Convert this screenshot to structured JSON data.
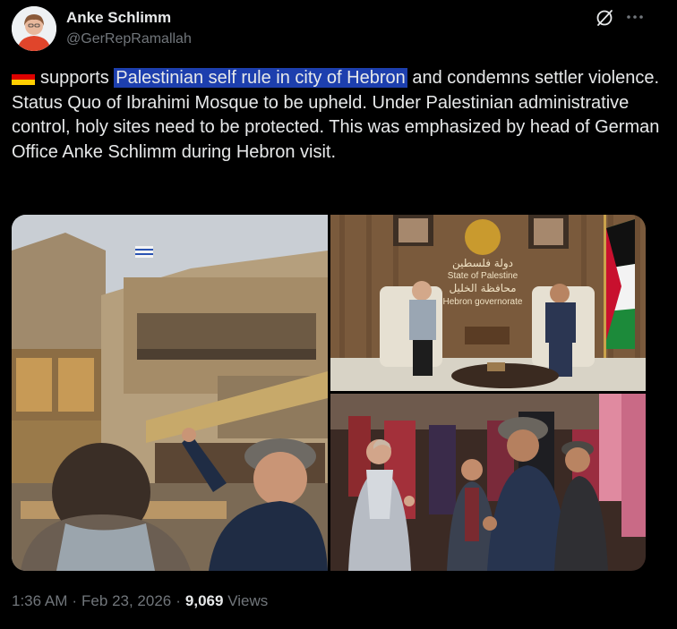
{
  "author": {
    "display_name": "Anke Schlimm",
    "handle": "@GerRepRamallah"
  },
  "post": {
    "flag_icon": "germany-flag-icon",
    "text_before": "supports ",
    "text_highlight": "Palestinian self rule in city of Hebron",
    "text_after": " and condemns settler violence. Status Quo of Ibrahimi Mosque to be upheld. Under Palestinian administrative control, holy sites need to be protected. This was emphasized by head of German Office Anke Schlimm during Hebron visit.",
    "highlight_color": "#1d3fae"
  },
  "media": {
    "photo_meeting": {
      "wall_sign_arabic_1": "دولة فلسطين",
      "wall_sign_english_1": "State of Palestine",
      "wall_sign_arabic_2": "محافظة الخليل",
      "wall_sign_english_2": "Hebron governorate"
    }
  },
  "meta": {
    "time": "1:36 AM",
    "date": "Feb 23, 2026",
    "views_count": "9,069",
    "views_label": "Views"
  },
  "colors": {
    "background": "#000000",
    "text": "#e7e9ea",
    "muted": "#71767b"
  }
}
